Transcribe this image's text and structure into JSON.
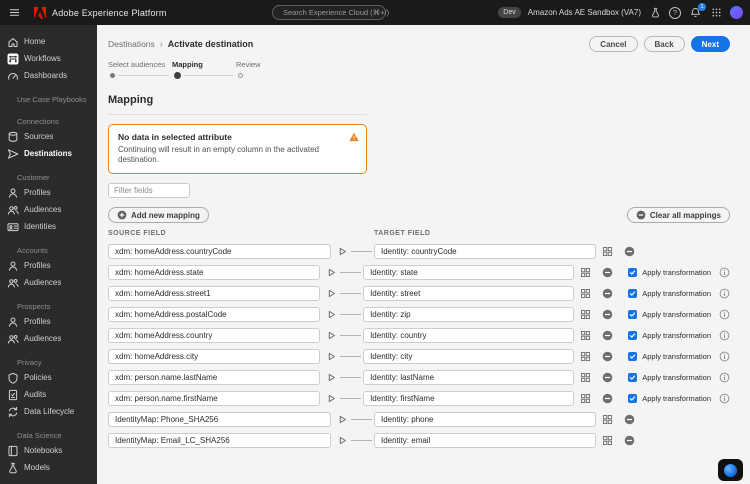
{
  "topbar": {
    "app_title": "Adobe Experience Platform",
    "search_placeholder": "Search Experience Cloud (⌘+/)",
    "env_badge": "Dev",
    "sandbox": "Amazon Ads AE Sandbox (VA7)",
    "notification_count": "1",
    "help_glyph": "?"
  },
  "sidebar": {
    "items": [
      {
        "label": "Home",
        "icon": "home-icon"
      },
      {
        "label": "Workflows",
        "icon": "workflows-icon"
      },
      {
        "label": "Dashboards",
        "icon": "dashboards-icon"
      },
      {
        "label": "Use Case Playbooks",
        "type": "section"
      },
      {
        "label": "Connections",
        "type": "section"
      },
      {
        "label": "Sources",
        "icon": "sources-icon"
      },
      {
        "label": "Destinations",
        "icon": "destinations-icon",
        "selected": true
      },
      {
        "label": "Customer",
        "type": "section"
      },
      {
        "label": "Profiles",
        "icon": "profile-icon"
      },
      {
        "label": "Audiences",
        "icon": "audiences-icon"
      },
      {
        "label": "Identities",
        "icon": "identities-icon"
      },
      {
        "label": "Accounts",
        "type": "section"
      },
      {
        "label": "Profiles",
        "icon": "profile-icon"
      },
      {
        "label": "Audiences",
        "icon": "audiences-icon"
      },
      {
        "label": "Prospects",
        "type": "section"
      },
      {
        "label": "Profiles",
        "icon": "profile-icon"
      },
      {
        "label": "Audiences",
        "icon": "audiences-icon"
      },
      {
        "label": "Privacy",
        "type": "section"
      },
      {
        "label": "Policies",
        "icon": "policies-icon"
      },
      {
        "label": "Audits",
        "icon": "audits-icon"
      },
      {
        "label": "Data Lifecycle",
        "icon": "data-lifecycle-icon"
      },
      {
        "label": "Data Science",
        "type": "section"
      },
      {
        "label": "Notebooks",
        "icon": "notebooks-icon"
      },
      {
        "label": "Models",
        "icon": "models-icon"
      }
    ]
  },
  "breadcrumb": {
    "parent": "Destinations",
    "separator": "›",
    "current": "Activate destination"
  },
  "actions": {
    "cancel": "Cancel",
    "back": "Back",
    "next": "Next"
  },
  "stepper": [
    {
      "label": "Select audiences",
      "state": "done"
    },
    {
      "label": "Mapping",
      "state": "current"
    },
    {
      "label": "Review",
      "state": "upcoming"
    }
  ],
  "mapping": {
    "heading": "Mapping",
    "warning": {
      "title": "No data in selected attribute",
      "description": "Continuing will result in an empty column in the activated destination."
    },
    "filter_placeholder": "Filter fields",
    "add_button": "Add new mapping",
    "clear_button": "Clear all mappings",
    "source_header": "SOURCE FIELD",
    "target_header": "TARGET FIELD",
    "apply_transformation_label": "Apply transformation",
    "rows": [
      {
        "source": "xdm: homeAddress.countryCode",
        "target": "Identity: countryCode",
        "transformation": false
      },
      {
        "source": "xdm: homeAddress.state",
        "target": "Identity: state",
        "transformation": true
      },
      {
        "source": "xdm: homeAddress.street1",
        "target": "Identity: street",
        "transformation": true
      },
      {
        "source": "xdm: homeAddress.postalCode",
        "target": "Identity: zip",
        "transformation": true
      },
      {
        "source": "xdm: homeAddress.country",
        "target": "Identity: country",
        "transformation": true
      },
      {
        "source": "xdm: homeAddress.city",
        "target": "Identity: city",
        "transformation": true
      },
      {
        "source": "xdm: person.name.lastName",
        "target": "Identity: lastName",
        "transformation": true
      },
      {
        "source": "xdm: person.name.firstName",
        "target": "Identity: firstName",
        "transformation": true
      },
      {
        "source": "IdentityMap: Phone_SHA256",
        "target": "Identity: phone",
        "transformation": false
      },
      {
        "source": "IdentityMap: Email_LC_SHA256",
        "target": "Identity: email",
        "transformation": false
      }
    ]
  },
  "colors": {
    "accent": "#1473e6",
    "warning": "#e68619",
    "topbar": "#1a1a1a",
    "sidebar": "#2b2b2b"
  }
}
